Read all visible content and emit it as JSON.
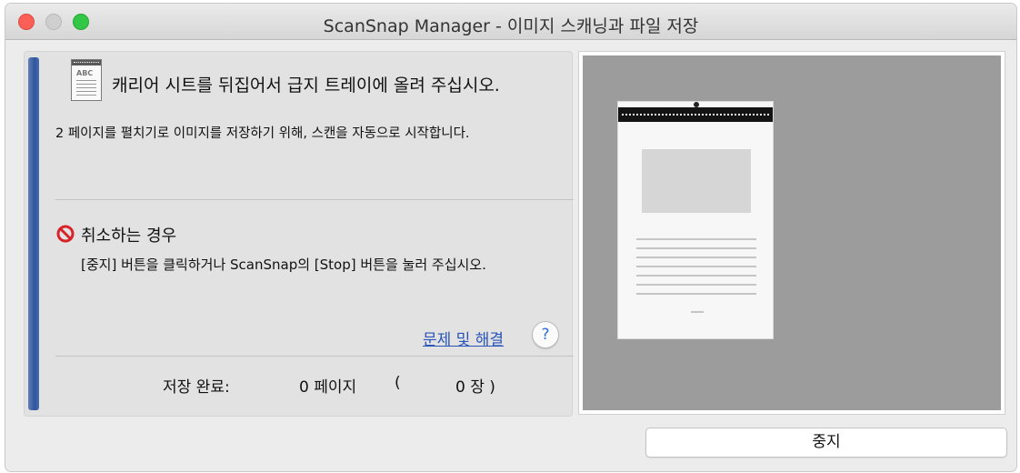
{
  "window": {
    "title": "ScanSnap Manager - 이미지 스캐닝과 파일 저장"
  },
  "instructions": {
    "doc_icon_label": "ABC",
    "headline": "캐리어 시트를 뒤집어서 급지 트레이에 올려 주십시오.",
    "subline": "2 페이지를 펼치기로 이미지를 저장하기 위해, 스캔을 자동으로 시작합니다."
  },
  "cancel": {
    "icon": "no-entry-icon",
    "title": "취소하는 경우",
    "text": "[중지] 버튼을 클릭하거나 ScanSnap의 [Stop] 버튼을 눌러 주십시오."
  },
  "help": {
    "link_label": "문제 및 해결",
    "button_label": "?"
  },
  "status": {
    "label": "저장 완료:",
    "pages": "0 페이지",
    "open_paren": "(",
    "sheets": "0 장 )"
  },
  "stop_button_label": "중지",
  "colors": {
    "accent": "#30559e",
    "link": "#2a55b8",
    "cancel_red": "#d8232a",
    "preview_bg": "#9c9c9c"
  }
}
